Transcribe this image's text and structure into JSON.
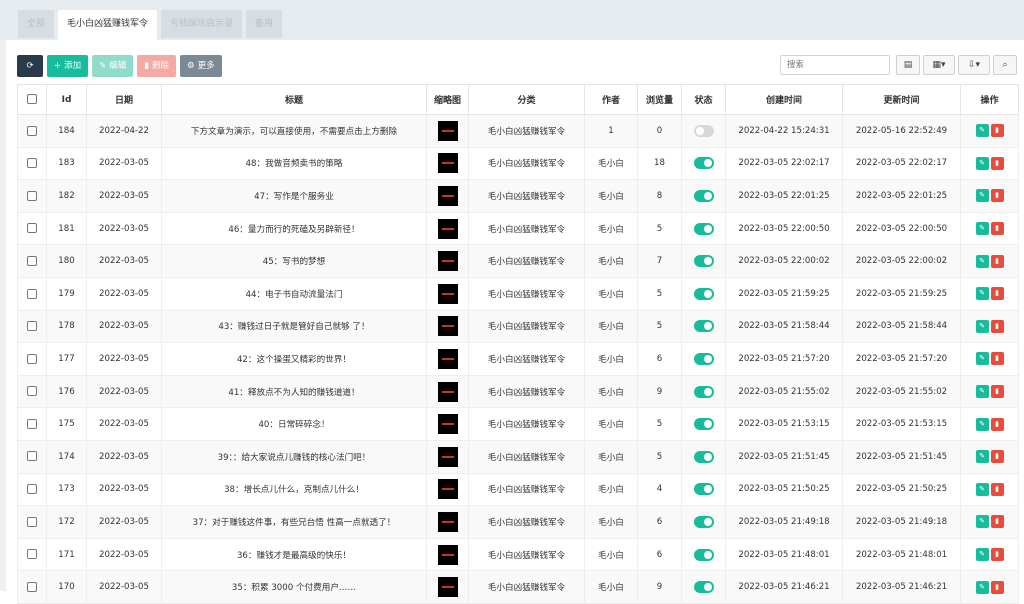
{
  "tabs": [
    {
      "label": "全部",
      "active": false
    },
    {
      "label": "毛小白凶猛赚钱军令",
      "active": true
    },
    {
      "label": "亏钱踩坑启示录",
      "active": false
    },
    {
      "label": "备用",
      "active": false
    }
  ],
  "toolbar": {
    "refresh_icon": "refresh-icon",
    "add": {
      "icon": "plus-icon",
      "label": "添加"
    },
    "edit": {
      "icon": "pencil-icon",
      "label": "编辑"
    },
    "delete": {
      "icon": "trash-icon",
      "label": "删除"
    },
    "more": {
      "icon": "gear-icon",
      "label": "更多"
    }
  },
  "search": {
    "placeholder": "搜索"
  },
  "right_tools": [
    "list-icon",
    "columns-icon",
    "export-icon",
    "search-icon"
  ],
  "table": {
    "headers": [
      "",
      "Id",
      "日期",
      "标题",
      "缩略图",
      "分类",
      "作者",
      "浏览量",
      "状态",
      "创建时间",
      "更新时间",
      "操作"
    ],
    "rows": [
      {
        "id": "184",
        "date": "2022-04-22",
        "title": "下方文章为演示，可以直接使用，不需要点击上方删除",
        "category": "毛小白凶猛赚钱军令",
        "author": "1",
        "views": "0",
        "status": false,
        "created": "2022-04-22 15:24:31",
        "updated": "2022-05-16 22:52:49"
      },
      {
        "id": "183",
        "date": "2022-03-05",
        "title": "48：我做音频卖书的策略",
        "category": "毛小白凶猛赚钱军令",
        "author": "毛小白",
        "views": "18",
        "status": true,
        "created": "2022-03-05 22:02:17",
        "updated": "2022-03-05 22:02:17"
      },
      {
        "id": "182",
        "date": "2022-03-05",
        "title": "47：写作是个服务业",
        "category": "毛小白凶猛赚钱军令",
        "author": "毛小白",
        "views": "8",
        "status": true,
        "created": "2022-03-05 22:01:25",
        "updated": "2022-03-05 22:01:25"
      },
      {
        "id": "181",
        "date": "2022-03-05",
        "title": "46：量力而行的死磕及另辟新径！",
        "category": "毛小白凶猛赚钱军令",
        "author": "毛小白",
        "views": "5",
        "status": true,
        "created": "2022-03-05 22:00:50",
        "updated": "2022-03-05 22:00:50"
      },
      {
        "id": "180",
        "date": "2022-03-05",
        "title": "45：写书的梦想",
        "category": "毛小白凶猛赚钱军令",
        "author": "毛小白",
        "views": "7",
        "status": true,
        "created": "2022-03-05 22:00:02",
        "updated": "2022-03-05 22:00:02"
      },
      {
        "id": "179",
        "date": "2022-03-05",
        "title": "44：电子书自动流量法门",
        "category": "毛小白凶猛赚钱军令",
        "author": "毛小白",
        "views": "5",
        "status": true,
        "created": "2022-03-05 21:59:25",
        "updated": "2022-03-05 21:59:25"
      },
      {
        "id": "178",
        "date": "2022-03-05",
        "title": "43：赚钱过日子就是管好自己就够 了！",
        "category": "毛小白凶猛赚钱军令",
        "author": "毛小白",
        "views": "5",
        "status": true,
        "created": "2022-03-05 21:58:44",
        "updated": "2022-03-05 21:58:44"
      },
      {
        "id": "177",
        "date": "2022-03-05",
        "title": "42：这个操蛋又精彩的世界！",
        "category": "毛小白凶猛赚钱军令",
        "author": "毛小白",
        "views": "6",
        "status": true,
        "created": "2022-03-05 21:57:20",
        "updated": "2022-03-05 21:57:20"
      },
      {
        "id": "176",
        "date": "2022-03-05",
        "title": "41：释放点不为人知的赚钱道道！",
        "category": "毛小白凶猛赚钱军令",
        "author": "毛小白",
        "views": "9",
        "status": true,
        "created": "2022-03-05 21:55:02",
        "updated": "2022-03-05 21:55:02"
      },
      {
        "id": "175",
        "date": "2022-03-05",
        "title": "40：日常碎碎念！",
        "category": "毛小白凶猛赚钱军令",
        "author": "毛小白",
        "views": "5",
        "status": true,
        "created": "2022-03-05 21:53:15",
        "updated": "2022-03-05 21:53:15"
      },
      {
        "id": "174",
        "date": "2022-03-05",
        "title": "39：：给大家说点儿赚钱的核心法门吧！",
        "category": "毛小白凶猛赚钱军令",
        "author": "毛小白",
        "views": "5",
        "status": true,
        "created": "2022-03-05 21:51:45",
        "updated": "2022-03-05 21:51:45"
      },
      {
        "id": "173",
        "date": "2022-03-05",
        "title": "38：增长点儿什么，克制点儿什么！",
        "category": "毛小白凶猛赚钱军令",
        "author": "毛小白",
        "views": "4",
        "status": true,
        "created": "2022-03-05 21:50:25",
        "updated": "2022-03-05 21:50:25"
      },
      {
        "id": "172",
        "date": "2022-03-05",
        "title": "37：对于赚钱这件事，有些兄台悟 性高一点就透了！",
        "category": "毛小白凶猛赚钱军令",
        "author": "毛小白",
        "views": "6",
        "status": true,
        "created": "2022-03-05 21:49:18",
        "updated": "2022-03-05 21:49:18"
      },
      {
        "id": "171",
        "date": "2022-03-05",
        "title": "36：赚钱才是最高级的快乐！",
        "category": "毛小白凶猛赚钱军令",
        "author": "毛小白",
        "views": "6",
        "status": true,
        "created": "2022-03-05 21:48:01",
        "updated": "2022-03-05 21:48:01"
      },
      {
        "id": "170",
        "date": "2022-03-05",
        "title": "35：积累 3000 个付费用户……",
        "category": "毛小白凶猛赚钱军令",
        "author": "毛小白",
        "views": "9",
        "status": true,
        "created": "2022-03-05 21:46:21",
        "updated": "2022-03-05 21:46:21"
      }
    ]
  },
  "row_actions": {
    "edit_icon": "pencil-icon",
    "delete_icon": "trash-icon"
  },
  "colors": {
    "accent": "#18bc9c",
    "danger": "#e74c3c",
    "dark": "#2b3a4a",
    "topbar": "#e6ebf0"
  }
}
